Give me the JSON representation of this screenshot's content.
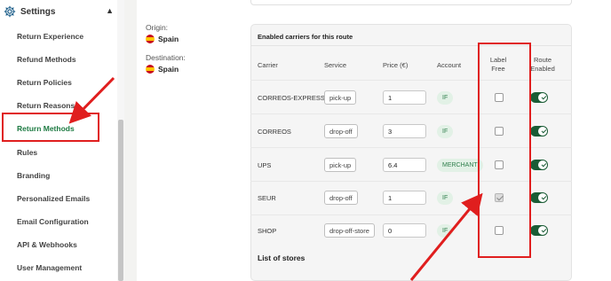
{
  "sidebar": {
    "header": {
      "label": "Settings",
      "icon": "gear-icon",
      "chevron": "chevron-up-icon"
    },
    "items": [
      {
        "label": "Return Experience",
        "active": false
      },
      {
        "label": "Refund Methods",
        "active": false
      },
      {
        "label": "Return Policies",
        "active": false
      },
      {
        "label": "Return Reasons",
        "active": false
      },
      {
        "label": "Return Methods",
        "active": true
      },
      {
        "label": "Rules",
        "active": false
      },
      {
        "label": "Branding",
        "active": false
      },
      {
        "label": "Personalized Emails",
        "active": false
      },
      {
        "label": "Email Configuration",
        "active": false
      },
      {
        "label": "API & Webhooks",
        "active": false
      },
      {
        "label": "User Management",
        "active": false
      }
    ]
  },
  "route": {
    "origin_label": "Origin:",
    "origin_value": "Spain",
    "destination_label": "Destination:",
    "destination_value": "Spain"
  },
  "carriers_panel": {
    "title": "Enabled carriers for this route",
    "columns": {
      "carrier": "Carrier",
      "service": "Service",
      "price": "Price (€)",
      "account": "Account",
      "label_free": "Label Free",
      "route_enabled": "Route Enabled"
    },
    "rows": [
      {
        "carrier": "CORREOS-EXPRESS",
        "service": "pick-up",
        "price": "1",
        "account": "IF",
        "label_free": false,
        "enabled": true
      },
      {
        "carrier": "CORREOS",
        "service": "drop-off",
        "price": "3",
        "account": "IF",
        "label_free": false,
        "enabled": true
      },
      {
        "carrier": "UPS",
        "service": "pick-up",
        "price": "6.4",
        "account": "MERCHANT",
        "label_free": false,
        "enabled": true
      },
      {
        "carrier": "SEUR",
        "service": "drop-off",
        "price": "1",
        "account": "IF",
        "label_free": true,
        "enabled": true
      },
      {
        "carrier": "SHOP",
        "service": "drop-off-store",
        "price": "0",
        "account": "IF",
        "label_free": false,
        "enabled": true
      }
    ],
    "stores_title": "List of stores"
  },
  "colors": {
    "accent_green": "#1a5c35",
    "active_text": "#1e7b43",
    "badge_bg": "#e2f1e6",
    "highlight_red": "#e01e1e"
  }
}
